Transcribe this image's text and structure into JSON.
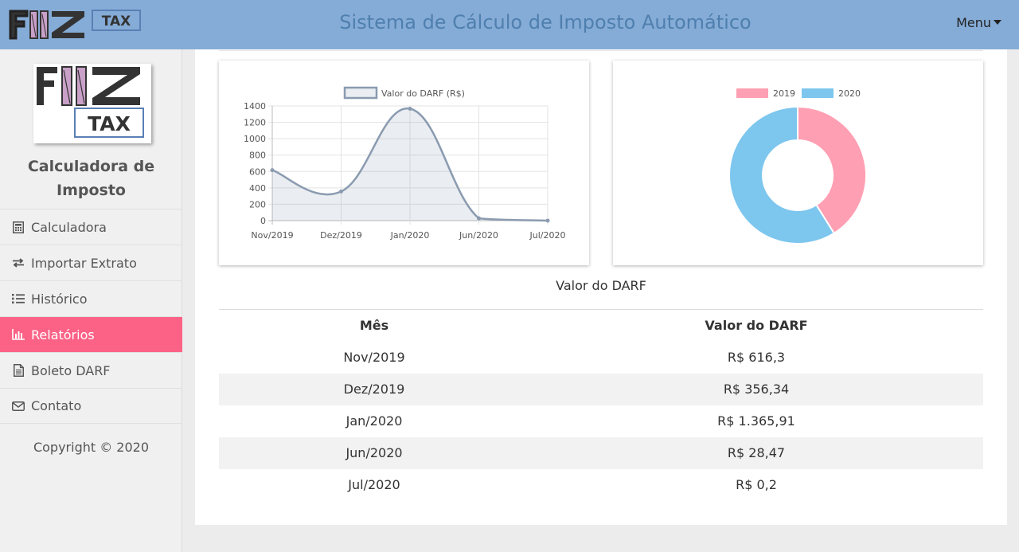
{
  "header": {
    "title": "Sistema de Cálculo de Imposto Automático",
    "menu_label": "Menu",
    "logo_text": "FIIZ TAX"
  },
  "sidebar": {
    "logo_text": "FIIZ TAX",
    "title": "Calculadora de Imposto",
    "items": [
      {
        "label": "Calculadora",
        "icon": "calculator-icon",
        "active": false
      },
      {
        "label": "Importar Extrato",
        "icon": "exchange-icon",
        "active": false
      },
      {
        "label": "Histórico",
        "icon": "list-icon",
        "active": false
      },
      {
        "label": "Relatórios",
        "icon": "bar-chart-icon",
        "active": true
      },
      {
        "label": "Boleto DARF",
        "icon": "document-icon",
        "active": false
      },
      {
        "label": "Contato",
        "icon": "envelope-icon",
        "active": false
      }
    ],
    "copyright": "Copyright © 2020"
  },
  "colors": {
    "header_bg": "#85acd7",
    "title": "#4f7fae",
    "active": "#fb6286",
    "line": "#8a9bb0",
    "pink": "#ff9fb3",
    "blue": "#7dc6ee"
  },
  "chart_data": [
    {
      "type": "line",
      "categories": [
        "Nov/2019",
        "Dez/2019",
        "Jan/2020",
        "Jun/2020",
        "Jul/2020"
      ],
      "series": [
        {
          "name": "Valor do DARF (R$)",
          "values": [
            616.3,
            356.34,
            1365.91,
            28.47,
            0.2
          ]
        }
      ],
      "yticks": [
        0,
        200,
        400,
        600,
        800,
        1000,
        1200,
        1400
      ],
      "ylim": [
        0,
        1400
      ],
      "grid": true,
      "legend": "top"
    },
    {
      "type": "pie",
      "categories": [
        "2019",
        "2020"
      ],
      "values": [
        972.64,
        1394.58
      ],
      "donut": true,
      "legend": "top"
    }
  ],
  "table": {
    "caption": "Valor do DARF",
    "headers": [
      "Mês",
      "Valor do DARF"
    ],
    "rows": [
      [
        "Nov/2019",
        "R$ 616,3"
      ],
      [
        "Dez/2019",
        "R$ 356,34"
      ],
      [
        "Jan/2020",
        "R$ 1.365,91"
      ],
      [
        "Jun/2020",
        "R$ 28,47"
      ],
      [
        "Jul/2020",
        "R$ 0,2"
      ]
    ]
  }
}
